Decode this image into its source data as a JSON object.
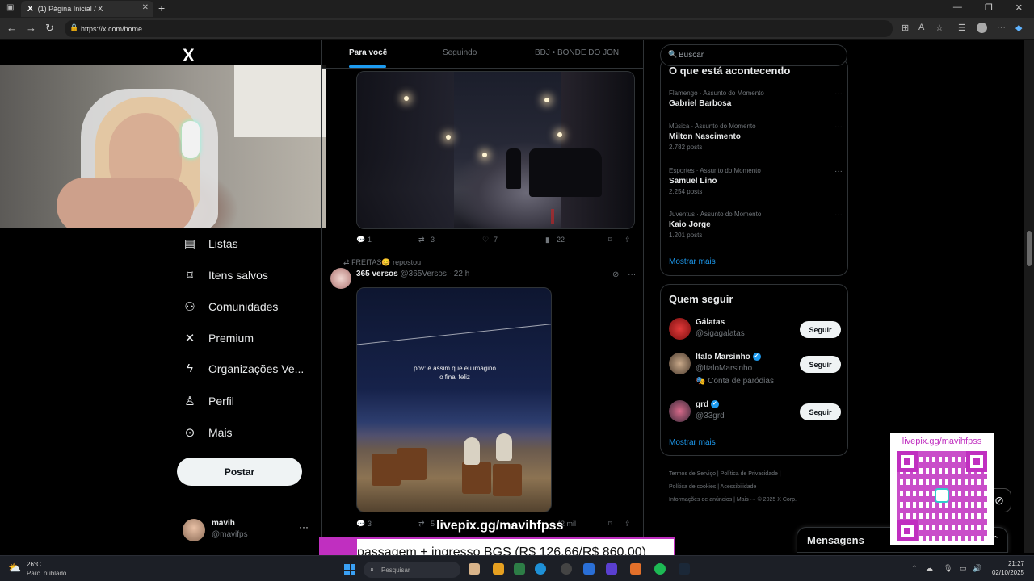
{
  "browser": {
    "tab_title": "(1) Página Inicial / X",
    "tab_icon": "X",
    "url": "https://x.com/home",
    "new_tab": "+",
    "close_tab": "✕"
  },
  "nav": {
    "logo": "X",
    "items": [
      {
        "label": "Listas",
        "icon": "list-icon"
      },
      {
        "label": "Itens salvos",
        "icon": "bookmark-icon"
      },
      {
        "label": "Comunidades",
        "icon": "communities-icon"
      },
      {
        "label": "Premium",
        "icon": "x-premium-icon"
      },
      {
        "label": "Organizações Ve...",
        "icon": "lightning-icon"
      },
      {
        "label": "Perfil",
        "icon": "profile-icon"
      },
      {
        "label": "Mais",
        "icon": "more-circle-icon"
      }
    ],
    "post_button": "Postar",
    "account": {
      "name": "mavih",
      "handle": "@mavifps",
      "more": "···"
    }
  },
  "feed": {
    "tabs": [
      "Para você",
      "Seguindo",
      "BDJ • BONDE DO JON"
    ],
    "active_tab": 0,
    "post1": {
      "replies": "1",
      "reposts": "3",
      "likes": "7",
      "views": "22"
    },
    "post2": {
      "repost_label": "FREITAS😊 repostou",
      "author": "365 versos",
      "handle": "@365Versos",
      "time": "· 22 h",
      "caption_line1": "pov: é assim que eu imagino",
      "caption_line2": "o final feliz",
      "replies": "3",
      "reposts": "5",
      "views": "42 mil"
    }
  },
  "sidebar": {
    "search_placeholder": "Buscar",
    "trends_title": "O que está acontecendo",
    "trends": [
      {
        "category": "Flamengo · Assunto do Momento",
        "name": "Gabriel Barbosa",
        "posts": ""
      },
      {
        "category": "Música · Assunto do Momento",
        "name": "Milton Nascimento",
        "posts": "2.782 posts"
      },
      {
        "category": "Esportes · Assunto do Momento",
        "name": "Samuel Lino",
        "posts": "2.254 posts"
      },
      {
        "category": "Juventus · Assunto do Momento",
        "name": "Kaio Jorge",
        "posts": "1.201 posts"
      }
    ],
    "trends_more": "Mostrar mais",
    "follow_title": "Quem seguir",
    "follow": [
      {
        "name": "Gálatas",
        "handle": "@sigagalatas",
        "extra": "",
        "verified": false,
        "button": "Seguir"
      },
      {
        "name": "Italo Marsinho",
        "handle": "@ItaloMarsinho",
        "extra": "🎭 Conta de paródias",
        "verified": true,
        "button": "Seguir"
      },
      {
        "name": "grd",
        "handle": "@33grd",
        "extra": "",
        "verified": true,
        "button": "Seguir"
      }
    ],
    "follow_more": "Mostrar mais",
    "footer": {
      "line1": "Termos de Serviço  |  Política de Privacidade  |",
      "line2": "Política de cookies  |  Acessibilidade  |",
      "line3": "Informações de anúncios  |  Mais ···  © 2025 X Corp."
    },
    "messages": "Mensagens"
  },
  "overlay": {
    "pix_label": "livepix.gg/mavihfpss",
    "banner_text": "passagem + ingresso BGS (R$ 126,66/R$ 860,00)",
    "qr_url": "livepix.gg/mavihfpss",
    "colors": {
      "accent": "#c02fc0",
      "link": "#1d9bf0"
    }
  },
  "taskbar": {
    "weather_temp": "26°C",
    "weather_cond": "Parc. nublado",
    "search_placeholder": "Pesquisar",
    "time": "21:27",
    "date": "02/10/2025"
  }
}
